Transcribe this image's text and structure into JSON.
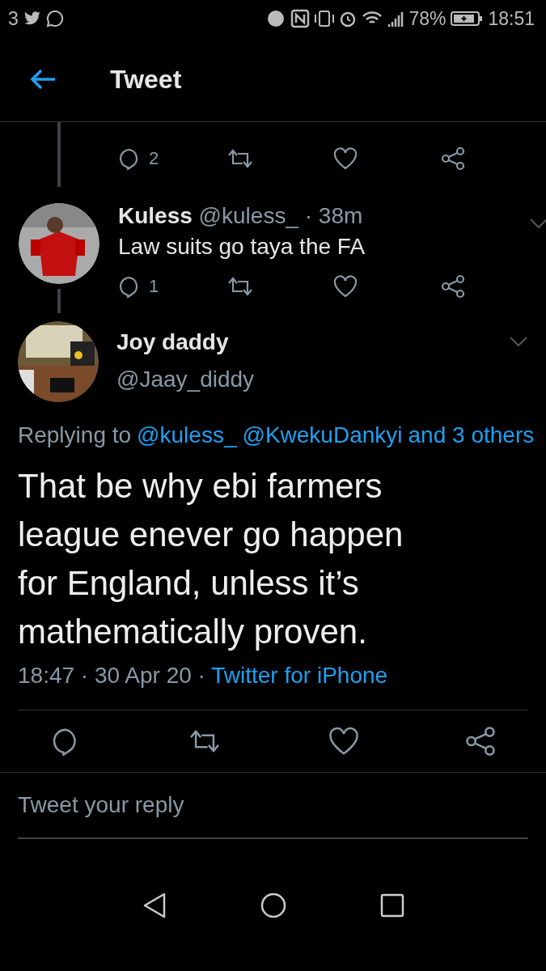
{
  "status_bar": {
    "notification_count": "3",
    "battery": "78%",
    "time": "18:51"
  },
  "header": {
    "title": "Tweet"
  },
  "parent_tweet_actions": {
    "replies": "2"
  },
  "replies": [
    {
      "name": "Kuless",
      "handle": "@kuless_",
      "separator": "·",
      "time": "38m",
      "text": "Law suits go taya the FA",
      "reply_count": "1"
    }
  ],
  "main_tweet": {
    "name": "Joy daddy",
    "handle": "@Jaay_diddy",
    "replying_label": "Replying to",
    "replying_links": [
      "@kuless_",
      "@KwekuDankyi",
      "and 3 others"
    ],
    "text": "That be why ebi farmers league enever go happen for England, unless it’s mathematically proven.",
    "time": "18:47",
    "separator": "·",
    "date": "30 Apr 20",
    "source": "Twitter for iPhone"
  },
  "reply_field": {
    "placeholder": "Tweet your reply"
  }
}
